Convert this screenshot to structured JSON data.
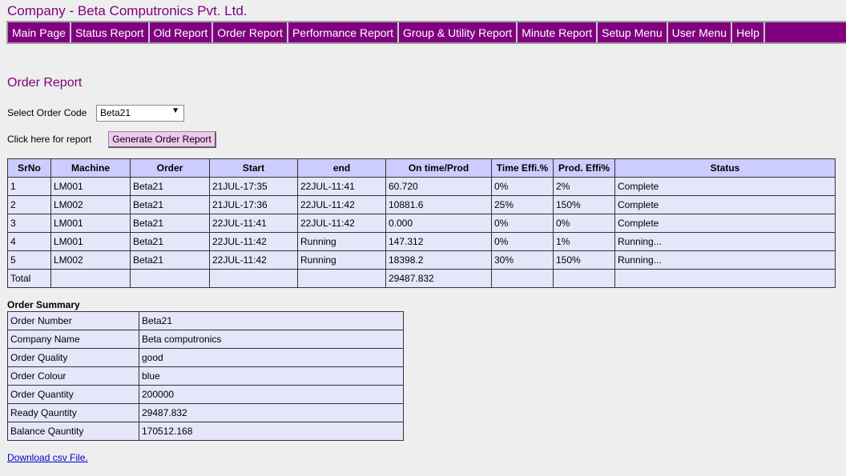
{
  "company_title": "Company - Beta Computronics Pvt. Ltd.",
  "nav": [
    "Main Page",
    "Status Report",
    "Old Report",
    "Order Report",
    "Performance Report",
    "Group & Utility Report",
    "Minute Report",
    "Setup Menu",
    "User Menu",
    "Help"
  ],
  "page_title": "Order Report",
  "select": {
    "label": "Select Order Code",
    "value": "Beta21"
  },
  "report": {
    "label": "Click here for report",
    "button": "Generate Order Report"
  },
  "order_table": {
    "headers": [
      "SrNo",
      "Machine",
      "Order",
      "Start",
      "end",
      "On time/Prod",
      "Time Effi.%",
      "Prod. Effi%",
      "Status"
    ],
    "rows": [
      [
        "1",
        "LM001",
        "Beta21",
        "21JUL-17:35",
        "22JUL-11:41",
        "60.720",
        "0%",
        "2%",
        "Complete"
      ],
      [
        "2",
        "LM002",
        "Beta21",
        "21JUL-17:36",
        "22JUL-11:42",
        "10881.6",
        "25%",
        "150%",
        "Complete"
      ],
      [
        "3",
        "LM001",
        "Beta21",
        "22JUL-11:41",
        "22JUL-11:42",
        "0.000",
        "0%",
        "0%",
        "Complete"
      ],
      [
        "4",
        "LM001",
        "Beta21",
        "22JUL-11:42",
        "Running",
        "147.312",
        "0%",
        "1%",
        "Running..."
      ],
      [
        "5",
        "LM002",
        "Beta21",
        "22JUL-11:42",
        "Running",
        "18398.2",
        "30%",
        "150%",
        "Running..."
      ],
      [
        "Total",
        "",
        "",
        "",
        "",
        "29487.832",
        "",
        "",
        ""
      ]
    ]
  },
  "summary": {
    "title": "Order Summary",
    "rows": [
      [
        "Order Number",
        "Beta21"
      ],
      [
        "Company Name",
        "Beta computronics"
      ],
      [
        "Order Quality",
        "good"
      ],
      [
        "Order Colour",
        "blue"
      ],
      [
        "Order Quantity",
        "200000"
      ],
      [
        "Ready Qauntity",
        "29487.832"
      ],
      [
        "Balance Qauntity",
        "170512.168"
      ]
    ]
  },
  "download_link": "Download csv File. "
}
